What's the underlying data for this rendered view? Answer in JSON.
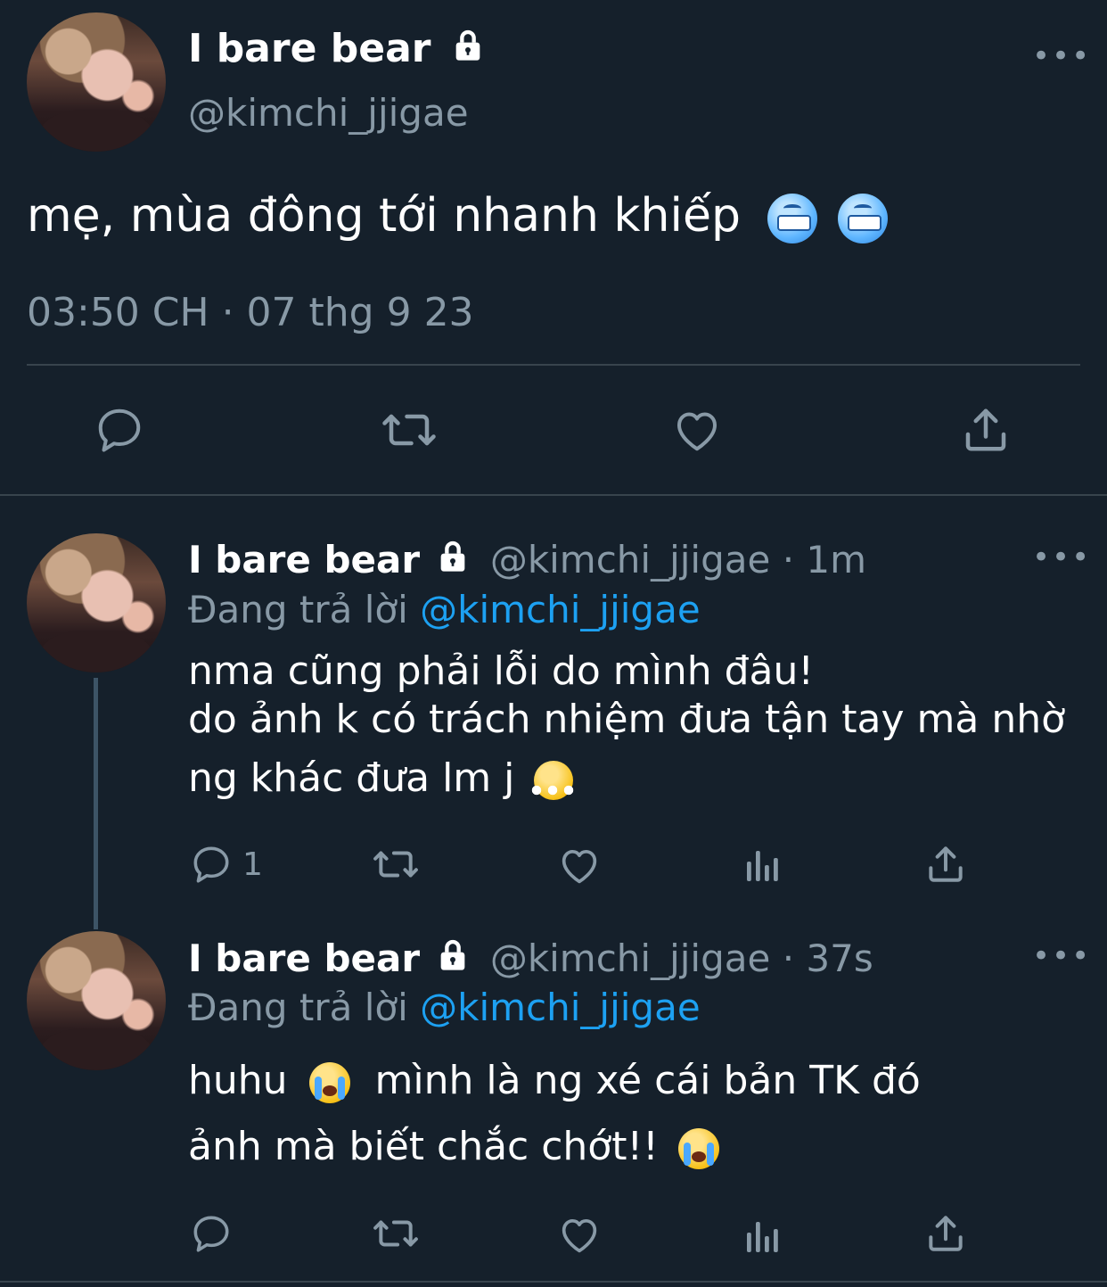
{
  "main_tweet": {
    "display_name": "I bare bear",
    "handle": "@kimchi_jjigae",
    "text": "mẹ, mùa đông tới nhanh khiếp",
    "timestamp": "03:50 CH · 07 thg 9 23"
  },
  "replies": [
    {
      "display_name": "I bare bear",
      "handle_time": "@kimchi_jjigae · 1m",
      "replying_label": "Đang trả lời",
      "replying_to": "@kimchi_jjigae",
      "line1": "nma cũng phải lỗi do mình đâu!",
      "line2": "do ảnh k có trách nhiệm đưa tận tay mà nhờ",
      "line3": "ng khác đưa lm j",
      "reply_count": "1"
    },
    {
      "display_name": "I bare bear",
      "handle_time": "@kimchi_jjigae · 37s",
      "replying_label": "Đang trả lời",
      "replying_to": "@kimchi_jjigae",
      "line1a": "huhu",
      "line1b": "mình là ng xé cái bản TK đó",
      "line2": "ảnh mà biết chắc chớt!!"
    }
  ],
  "icons": [
    "lock-icon",
    "more-icon",
    "reply-icon",
    "retweet-icon",
    "like-icon",
    "share-icon",
    "analytics-icon",
    "cold-face-emoji",
    "huffing-face-emoji",
    "crying-face-emoji"
  ],
  "colors": {
    "background": "#15202b",
    "accent": "#1da1f2",
    "muted": "#8899a6",
    "divider": "#38444d"
  }
}
